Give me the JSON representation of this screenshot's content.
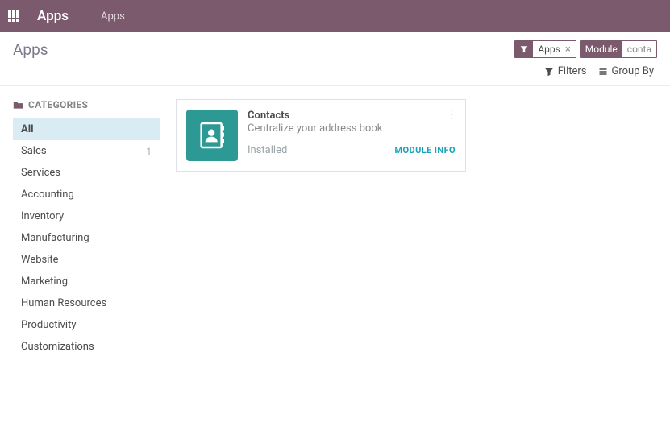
{
  "navbar": {
    "brand": "Apps",
    "menu_item": "Apps"
  },
  "control": {
    "title": "Apps",
    "search_tags": {
      "apps": {
        "label": "Apps",
        "close": "×"
      },
      "module": {
        "badge": "Module",
        "value": "conta"
      }
    },
    "filters_label": "Filters",
    "groupby_label": "Group By"
  },
  "sidebar": {
    "header": "CATEGORIES",
    "items": [
      {
        "label": "All",
        "count": "",
        "selected": true
      },
      {
        "label": "Sales",
        "count": "1",
        "selected": false
      },
      {
        "label": "Services",
        "count": "",
        "selected": false
      },
      {
        "label": "Accounting",
        "count": "",
        "selected": false
      },
      {
        "label": "Inventory",
        "count": "",
        "selected": false
      },
      {
        "label": "Manufacturing",
        "count": "",
        "selected": false
      },
      {
        "label": "Website",
        "count": "",
        "selected": false
      },
      {
        "label": "Marketing",
        "count": "",
        "selected": false
      },
      {
        "label": "Human Resources",
        "count": "",
        "selected": false
      },
      {
        "label": "Productivity",
        "count": "",
        "selected": false
      },
      {
        "label": "Customizations",
        "count": "",
        "selected": false
      }
    ]
  },
  "module": {
    "name": "Contacts",
    "description": "Centralize your address book",
    "status": "Installed",
    "info_button": "MODULE INFO"
  }
}
